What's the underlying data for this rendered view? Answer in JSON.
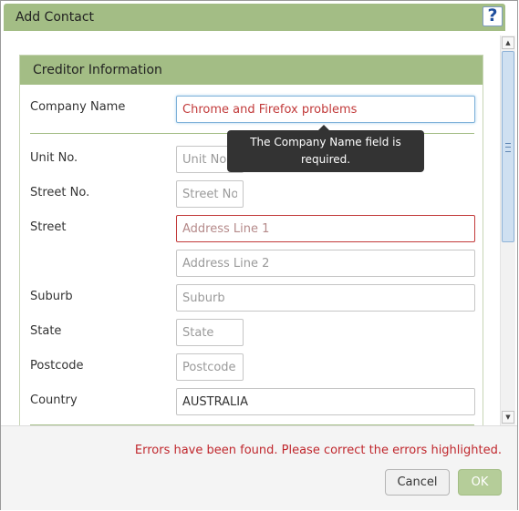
{
  "dialog": {
    "title": "Add Contact",
    "help_icon": "?"
  },
  "section": {
    "title": "Creditor Information"
  },
  "form": {
    "company_name": {
      "label": "Company Name",
      "value": "Chrome and Firefox problems"
    },
    "unit_no": {
      "label": "Unit No.",
      "placeholder": "Unit No"
    },
    "street_no": {
      "label": "Street No.",
      "placeholder": "Street No"
    },
    "street": {
      "label": "Street",
      "placeholder_line1": "Address Line 1",
      "placeholder_line2": "Address Line 2"
    },
    "suburb": {
      "label": "Suburb",
      "placeholder": "Suburb"
    },
    "state": {
      "label": "State",
      "placeholder": "State"
    },
    "postcode": {
      "label": "Postcode",
      "placeholder": "Postcode"
    },
    "country": {
      "label": "Country",
      "value": "AUSTRALIA"
    }
  },
  "tooltip": {
    "text": "The Company Name field is required."
  },
  "scrollbar": {
    "up_arrow": "▲",
    "down_arrow": "▼"
  },
  "footer": {
    "error_message": "Errors have been found. Please correct the errors highlighted.",
    "cancel_label": "Cancel",
    "ok_label": "OK"
  },
  "colors": {
    "header_green": "#a3bd85",
    "error_red": "#c0272d",
    "tooltip_bg": "#333333"
  }
}
